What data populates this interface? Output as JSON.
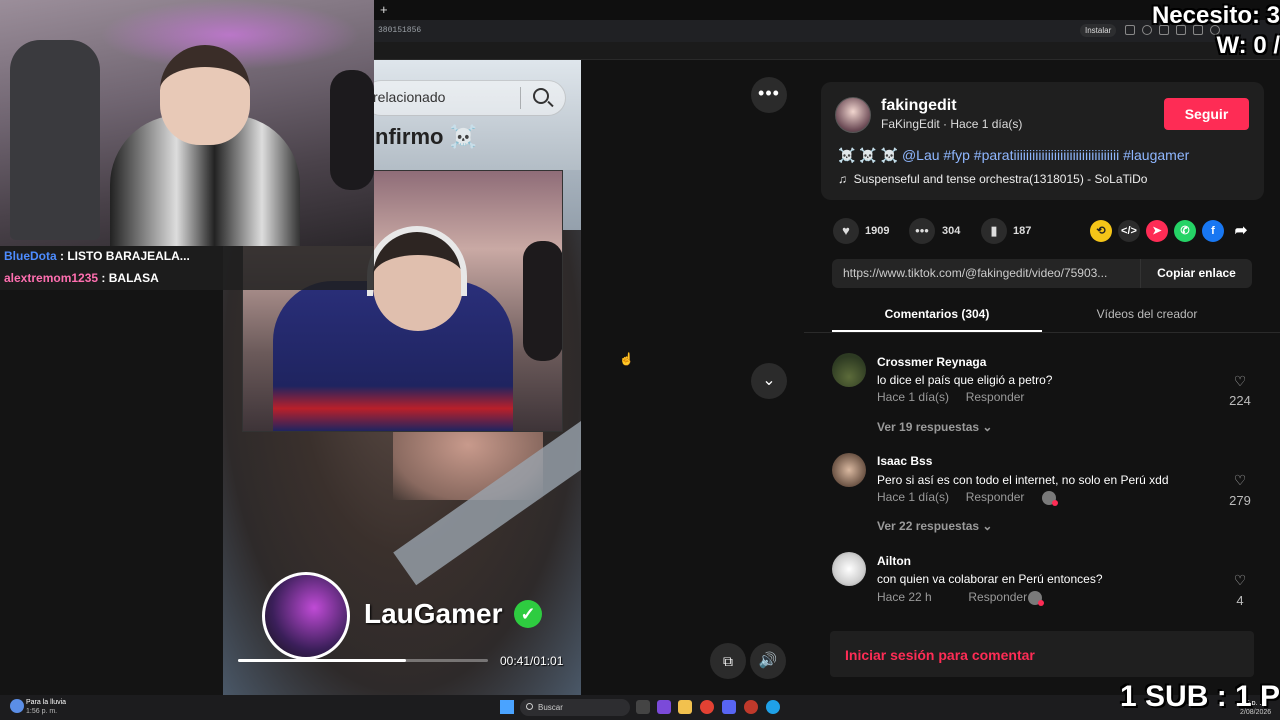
{
  "browser": {
    "new_tab_glyph": "+",
    "url_fragment": "380151856",
    "install_label": "Instalar"
  },
  "overlay": {
    "goal_line1": "Necesito: 3",
    "goal_line2": "W: 0 /",
    "sub_text": "1 SUB : 1 P"
  },
  "chat": {
    "messages": [
      {
        "user": "BlueDota",
        "text": ": LISTO BARAJEALA..."
      },
      {
        "user": "alextremom1235",
        "text": ": BALASA"
      }
    ]
  },
  "video": {
    "search_text": "relacionado",
    "overlay_text": "nfirmo ☠️",
    "creator_name": "LauGamer",
    "time": "00:41/01:01",
    "progress": 0.67
  },
  "controls": {
    "more_glyph": "•••",
    "down_glyph": "⌄",
    "pip_glyph": "⧉",
    "volume_glyph": "🔊"
  },
  "post": {
    "handle": "fakingedit",
    "meta": "FaKingEdit · Hace 1 día(s)",
    "follow_label": "Seguir",
    "caption_prefix": "☠️ ☠️ ☠️ ",
    "caption_tags": "@Lau #fyp #paratiiiiiiiiiiiiiiiiiiiiiiiiiiiiiiiiii #laugamer",
    "sound": "Suspenseful and tense orchestra(1318015) - SoLaTiDo",
    "sound_glyph": "♫"
  },
  "stats": {
    "likes": "1909",
    "comments": "304",
    "saves": "187"
  },
  "share": {
    "url": "https://www.tiktok.com/@fakingedit/video/75903...",
    "copy_label": "Copiar enlace"
  },
  "tabs": {
    "comments": "Comentarios (304)",
    "videos": "Vídeos del creador"
  },
  "comments": [
    {
      "user": "Crossmer Reynaga",
      "text": "lo dice el país que eligió a petro?",
      "time": "Hace 1 día(s)",
      "reply": "Responder",
      "likes": "224",
      "view_replies": "Ver 19 respuestas"
    },
    {
      "user": "Isaac Bss",
      "text": "Pero si así es con todo el internet, no solo en Perú xdd",
      "time": "Hace 1 día(s)",
      "reply": "Responder",
      "likes": "279",
      "view_replies": "Ver 22 respuestas"
    },
    {
      "user": "Ailton",
      "text": "con quien va colaborar en Perú entonces?",
      "time": "Hace 22 h",
      "reply": "Responder",
      "likes": "4"
    }
  ],
  "login": {
    "label": "Iniciar sesión para comentar"
  },
  "taskbar": {
    "weather_title": "Para la lluvia",
    "weather_time": "1:56 p. m.",
    "search_label": "Buscar",
    "clock_time": "1:5 p. m.",
    "clock_date": "2/08/2026"
  },
  "colors": {
    "accent": "#fe2c55",
    "tag": "#8fb7ff",
    "verified": "#2ecc40"
  }
}
